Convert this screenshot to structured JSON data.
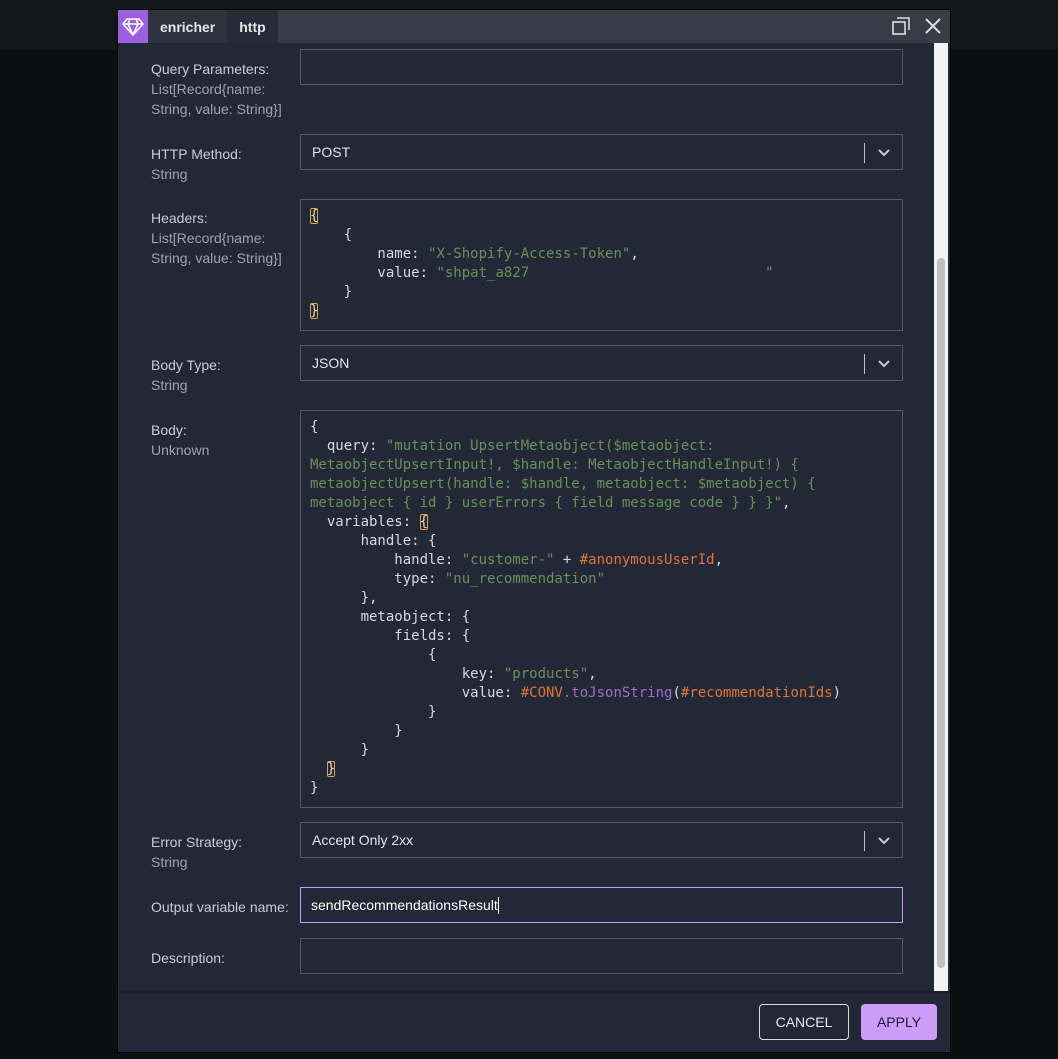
{
  "window": {
    "tabs": [
      "enricher",
      "http"
    ],
    "logo_icon": "diamond-icon",
    "accent": "#9b5fe0"
  },
  "fields": {
    "query_params": {
      "label": "Query Parameters:",
      "type_lines": [
        "List[Record{name:",
        "String, value: String}]"
      ],
      "value": ""
    },
    "http_method": {
      "label": "HTTP Method:",
      "type": "String",
      "value": "POST"
    },
    "headers": {
      "label": "Headers:",
      "type_lines": [
        "List[Record{name:",
        "String, value: String}]"
      ]
    },
    "body_type": {
      "label": "Body Type:",
      "type": "String",
      "value": "JSON"
    },
    "body": {
      "label": "Body:",
      "type": "Unknown"
    },
    "error_strategy": {
      "label": "Error Strategy:",
      "type": "String",
      "value": "Accept Only 2xx"
    },
    "output_var": {
      "label": "Output variable name:",
      "value": "sendRecommendationsResult"
    },
    "description": {
      "label": "Description:",
      "value": ""
    }
  },
  "headers_code": [
    [
      {
        "t": "{",
        "c": "b"
      }
    ],
    [
      {
        "t": "    {",
        "c": "k"
      }
    ],
    [
      {
        "t": "        name: ",
        "c": "k"
      },
      {
        "t": "\"X-Shopify-Access-Token\"",
        "c": "s"
      },
      {
        "t": ",",
        "c": "k"
      }
    ],
    [
      {
        "t": "        value: ",
        "c": "k"
      },
      {
        "t": "\"shpat_a827                            \"",
        "c": "s"
      }
    ],
    [
      {
        "t": "    }",
        "c": "k"
      }
    ],
    [
      {
        "t": "}",
        "c": "b"
      }
    ]
  ],
  "body_code": [
    [
      {
        "t": "{",
        "c": "k"
      }
    ],
    [
      {
        "t": "  query: ",
        "c": "k"
      },
      {
        "t": "\"mutation UpsertMetaobject($metaobject:",
        "c": "s"
      }
    ],
    [
      {
        "t": "MetaobjectUpsertInput!, $handle: MetaobjectHandleInput!) {",
        "c": "s"
      }
    ],
    [
      {
        "t": "metaobjectUpsert(handle: $handle, metaobject: $metaobject) {",
        "c": "s"
      }
    ],
    [
      {
        "t": "metaobject { id } userErrors { field message code } } }\"",
        "c": "s"
      },
      {
        "t": ",",
        "c": "k"
      }
    ],
    [
      {
        "t": "  variables: ",
        "c": "k"
      },
      {
        "t": "{",
        "c": "b"
      }
    ],
    [
      {
        "t": "      handle: {",
        "c": "k"
      }
    ],
    [
      {
        "t": "          handle: ",
        "c": "k"
      },
      {
        "t": "\"customer-\"",
        "c": "s"
      },
      {
        "t": " + ",
        "c": "k"
      },
      {
        "t": "#anonymousUserId",
        "c": "o"
      },
      {
        "t": ",",
        "c": "k"
      }
    ],
    [
      {
        "t": "          type: ",
        "c": "k"
      },
      {
        "t": "\"nu_recommendation\"",
        "c": "s"
      }
    ],
    [
      {
        "t": "      },",
        "c": "k"
      }
    ],
    [
      {
        "t": "      metaobject: {",
        "c": "k"
      }
    ],
    [
      {
        "t": "          fields: {",
        "c": "k"
      }
    ],
    [
      {
        "t": "              {",
        "c": "k"
      }
    ],
    [
      {
        "t": "                  key: ",
        "c": "k"
      },
      {
        "t": "\"products\"",
        "c": "s"
      },
      {
        "t": ",",
        "c": "k"
      }
    ],
    [
      {
        "t": "                  value: ",
        "c": "k"
      },
      {
        "t": "#CONV",
        "c": "o"
      },
      {
        "t": ".toJsonString",
        "c": "p"
      },
      {
        "t": "(",
        "c": "k"
      },
      {
        "t": "#recommendationIds",
        "c": "o"
      },
      {
        "t": ")",
        "c": "k"
      }
    ],
    [
      {
        "t": "              }",
        "c": "k"
      }
    ],
    [
      {
        "t": "          }",
        "c": "k"
      }
    ],
    [
      {
        "t": "      }",
        "c": "k"
      }
    ],
    [
      {
        "t": "  ",
        "c": "k"
      },
      {
        "t": "}",
        "c": "b"
      }
    ],
    [
      {
        "t": "}",
        "c": "k"
      }
    ]
  ],
  "footer": {
    "cancel": "CANCEL",
    "apply": "APPLY"
  }
}
